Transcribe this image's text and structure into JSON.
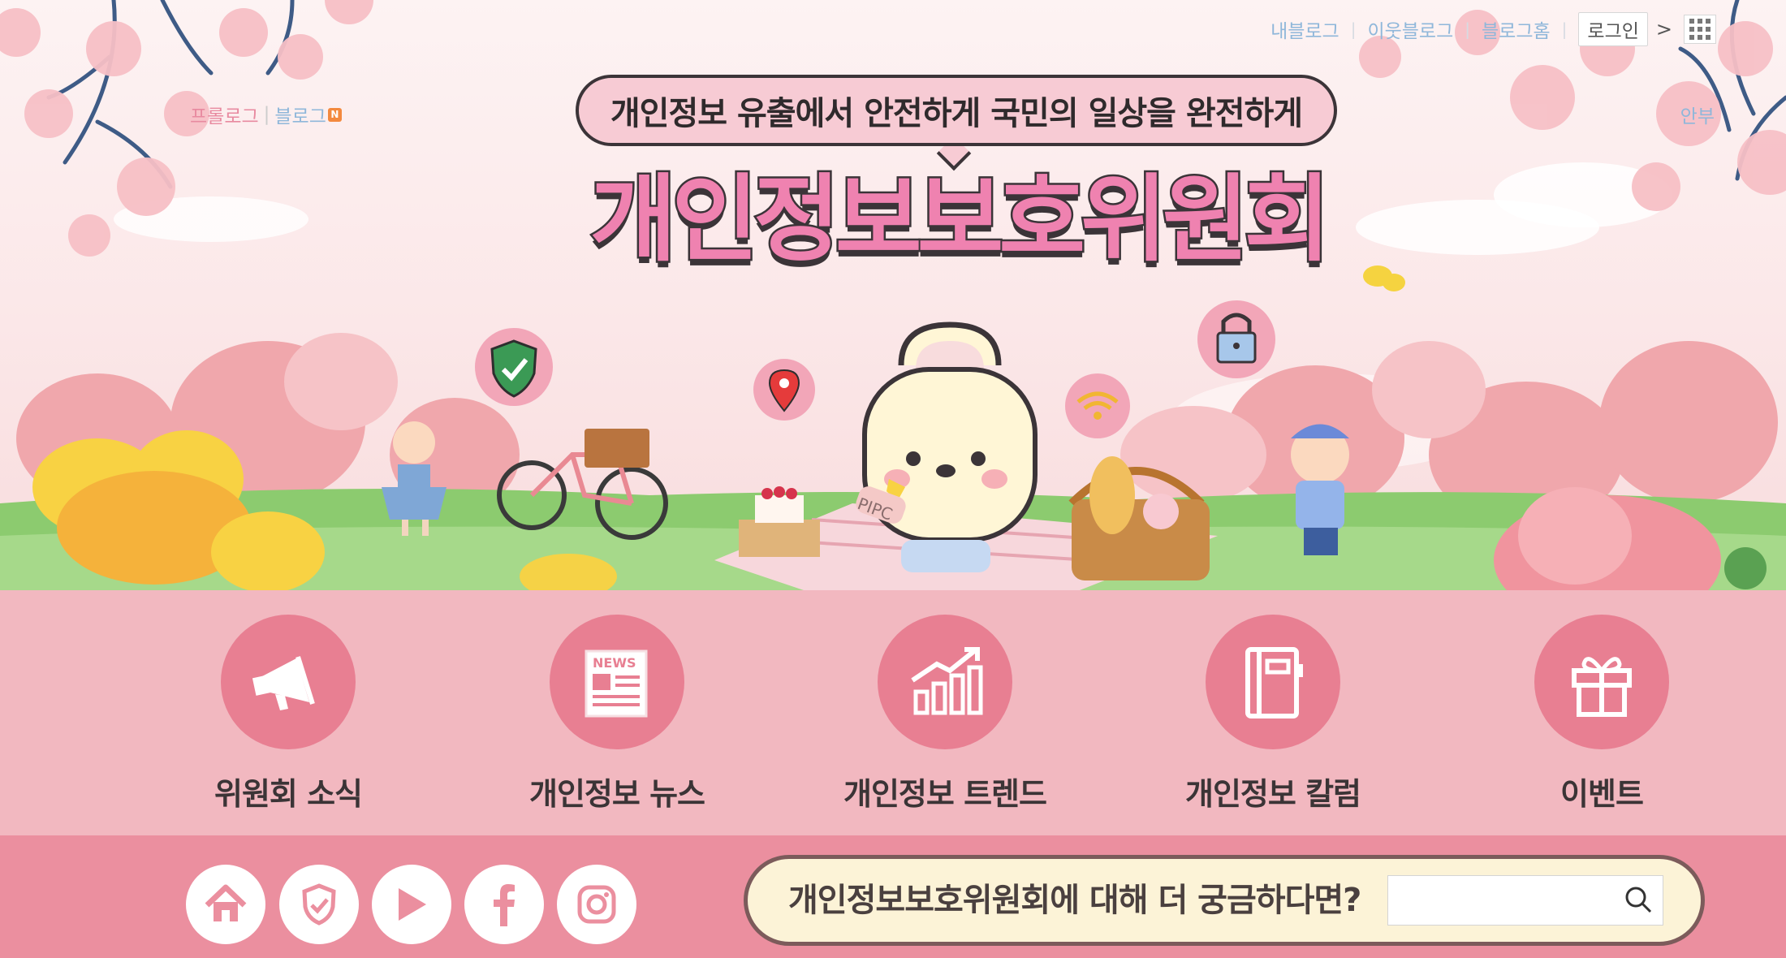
{
  "top_nav": {
    "my_blog": "내블로그",
    "neighbor_blog": "이웃블로그",
    "blog_home": "블로그홈",
    "login": "로그인"
  },
  "left_nav": {
    "prologue": "프롤로그",
    "blog": "블로그",
    "blog_badge": "N"
  },
  "right_nav": {
    "info": "안부"
  },
  "hero": {
    "slogan": "개인정보 유출에서 안전하게 국민의 일상을 완전하게",
    "title": "개인정보보호위원회",
    "mascot_tag": "PIPC"
  },
  "menu": {
    "items": [
      {
        "label": "위원회 소식",
        "icon": "megaphone-icon"
      },
      {
        "label": "개인정보 뉴스",
        "icon": "newspaper-icon",
        "icon_text": "NEWS"
      },
      {
        "label": "개인정보 트렌드",
        "icon": "trend-chart-icon"
      },
      {
        "label": "개인정보 칼럼",
        "icon": "notebook-icon"
      },
      {
        "label": "이벤트",
        "icon": "gift-icon"
      }
    ]
  },
  "footer": {
    "social": [
      "home-icon",
      "shield-check-icon",
      "youtube-play-icon",
      "facebook-icon",
      "instagram-icon"
    ],
    "search_prompt": "개인정보보호위원회에 대해 더 궁금하다면?",
    "search_value": "",
    "search_icon": "search-icon"
  },
  "colors": {
    "menu_band": "#f2b8c0",
    "menu_circle": "#e87f92",
    "footer_band": "#eb8f9f",
    "title_pink": "#ef82b0",
    "search_pill": "#fcf3d7",
    "link_blue": "#8fb7da"
  }
}
